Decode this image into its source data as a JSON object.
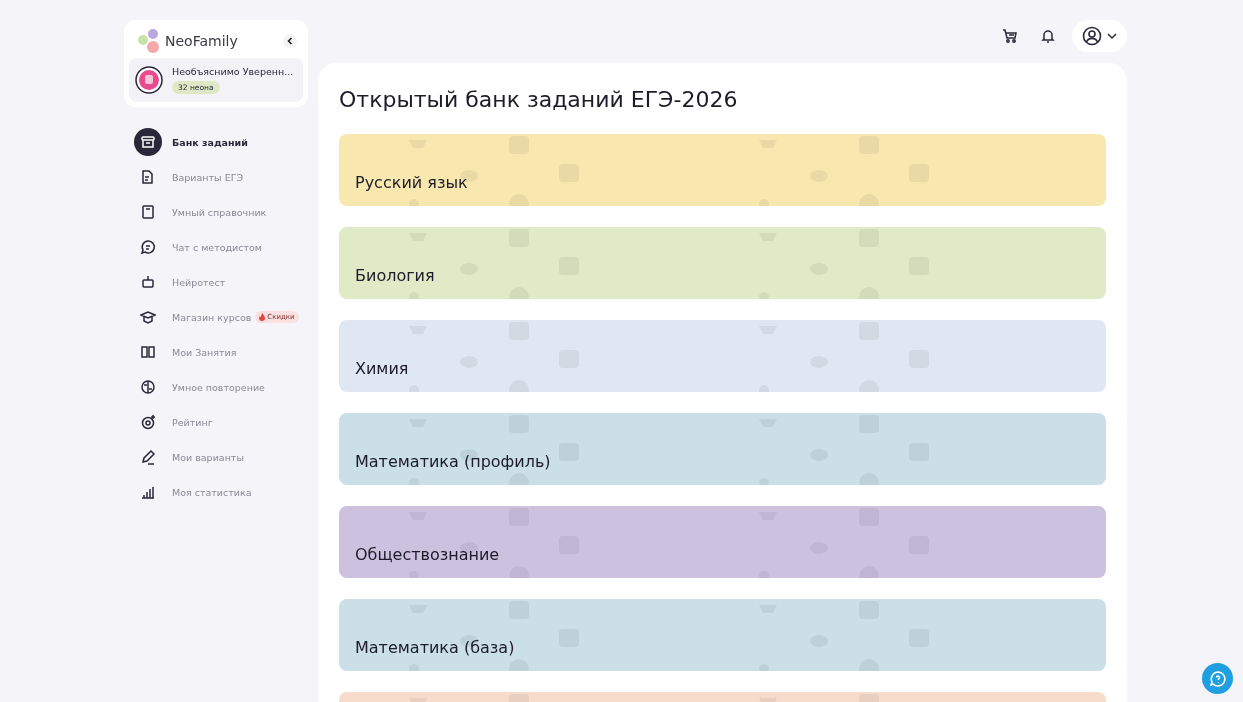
{
  "logo": {
    "text": "NeoFamily"
  },
  "profile": {
    "name": "Необъяснимо Уверенн...",
    "balance": "32 неона"
  },
  "sidebar": {
    "items": [
      {
        "label": "Банк заданий",
        "selected": true
      },
      {
        "label": "Варианты ЕГЭ",
        "selected": false
      },
      {
        "label": "Умный справочник",
        "selected": false
      },
      {
        "label": "Чат с методистом",
        "selected": false
      },
      {
        "label": "Нейротест",
        "selected": false
      },
      {
        "label": "Магазин курсов",
        "selected": false,
        "badge": "Скидки"
      },
      {
        "label": "Мои Занятия",
        "selected": false
      },
      {
        "label": "Умное повторение",
        "selected": false
      },
      {
        "label": "Рейтинг",
        "selected": false
      },
      {
        "label": "Мои варианты",
        "selected": false
      },
      {
        "label": "Моя статистика",
        "selected": false
      }
    ]
  },
  "page": {
    "title": "Открытый банк заданий ЕГЭ-2026"
  },
  "subjects": [
    {
      "title": "Русский язык",
      "color": "#f8e8b0"
    },
    {
      "title": "Биология",
      "color": "#e0eac6"
    },
    {
      "title": "Химия",
      "color": "#dfe8f2"
    },
    {
      "title": "Математика (профиль)",
      "color": "#cadfe7"
    },
    {
      "title": "Обществознание",
      "color": "#cdc1e0"
    },
    {
      "title": "Математика (база)",
      "color": "#cadfe7"
    },
    {
      "color": "#f8dccb"
    }
  ]
}
